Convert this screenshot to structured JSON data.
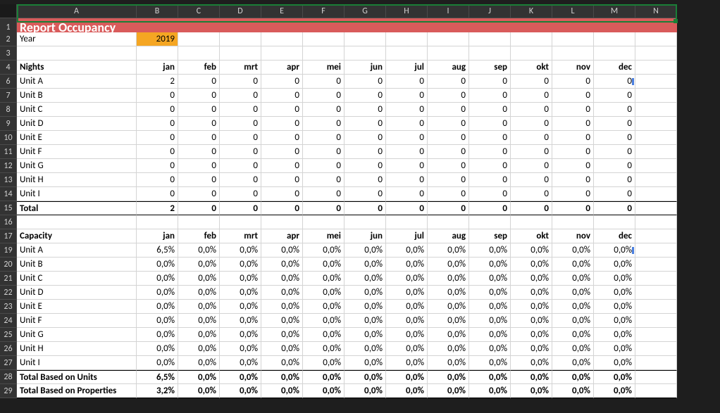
{
  "columns": [
    "A",
    "B",
    "C",
    "D",
    "E",
    "F",
    "G",
    "H",
    "I",
    "J",
    "K",
    "L",
    "M",
    "N"
  ],
  "row_numbers": [
    1,
    2,
    3,
    4,
    6,
    7,
    8,
    9,
    10,
    11,
    12,
    13,
    14,
    15,
    16,
    17,
    19,
    20,
    21,
    22,
    23,
    24,
    25,
    26,
    27,
    28,
    29
  ],
  "title": "Report Occupancy",
  "year_label": "Year",
  "year_value": "2019",
  "months": [
    "jan",
    "feb",
    "mrt",
    "apr",
    "mei",
    "jun",
    "jul",
    "aug",
    "sep",
    "okt",
    "nov",
    "dec"
  ],
  "section_nights": "Nights",
  "section_capacity": "Capacity",
  "units": [
    "Unit A",
    "Unit B",
    "Unit C",
    "Unit D",
    "Unit E",
    "Unit F",
    "Unit G",
    "Unit H",
    "Unit I"
  ],
  "nights_data": [
    [
      2,
      0,
      0,
      0,
      0,
      0,
      0,
      0,
      0,
      0,
      0,
      0
    ],
    [
      0,
      0,
      0,
      0,
      0,
      0,
      0,
      0,
      0,
      0,
      0,
      0
    ],
    [
      0,
      0,
      0,
      0,
      0,
      0,
      0,
      0,
      0,
      0,
      0,
      0
    ],
    [
      0,
      0,
      0,
      0,
      0,
      0,
      0,
      0,
      0,
      0,
      0,
      0
    ],
    [
      0,
      0,
      0,
      0,
      0,
      0,
      0,
      0,
      0,
      0,
      0,
      0
    ],
    [
      0,
      0,
      0,
      0,
      0,
      0,
      0,
      0,
      0,
      0,
      0,
      0
    ],
    [
      0,
      0,
      0,
      0,
      0,
      0,
      0,
      0,
      0,
      0,
      0,
      0
    ],
    [
      0,
      0,
      0,
      0,
      0,
      0,
      0,
      0,
      0,
      0,
      0,
      0
    ],
    [
      0,
      0,
      0,
      0,
      0,
      0,
      0,
      0,
      0,
      0,
      0,
      0
    ]
  ],
  "nights_total_label": "Total",
  "nights_total": [
    2,
    0,
    0,
    0,
    0,
    0,
    0,
    0,
    0,
    0,
    0,
    0
  ],
  "capacity_data": [
    [
      "6,5%",
      "0,0%",
      "0,0%",
      "0,0%",
      "0,0%",
      "0,0%",
      "0,0%",
      "0,0%",
      "0,0%",
      "0,0%",
      "0,0%",
      "0,0%"
    ],
    [
      "0,0%",
      "0,0%",
      "0,0%",
      "0,0%",
      "0,0%",
      "0,0%",
      "0,0%",
      "0,0%",
      "0,0%",
      "0,0%",
      "0,0%",
      "0,0%"
    ],
    [
      "0,0%",
      "0,0%",
      "0,0%",
      "0,0%",
      "0,0%",
      "0,0%",
      "0,0%",
      "0,0%",
      "0,0%",
      "0,0%",
      "0,0%",
      "0,0%"
    ],
    [
      "0,0%",
      "0,0%",
      "0,0%",
      "0,0%",
      "0,0%",
      "0,0%",
      "0,0%",
      "0,0%",
      "0,0%",
      "0,0%",
      "0,0%",
      "0,0%"
    ],
    [
      "0,0%",
      "0,0%",
      "0,0%",
      "0,0%",
      "0,0%",
      "0,0%",
      "0,0%",
      "0,0%",
      "0,0%",
      "0,0%",
      "0,0%",
      "0,0%"
    ],
    [
      "0,0%",
      "0,0%",
      "0,0%",
      "0,0%",
      "0,0%",
      "0,0%",
      "0,0%",
      "0,0%",
      "0,0%",
      "0,0%",
      "0,0%",
      "0,0%"
    ],
    [
      "0,0%",
      "0,0%",
      "0,0%",
      "0,0%",
      "0,0%",
      "0,0%",
      "0,0%",
      "0,0%",
      "0,0%",
      "0,0%",
      "0,0%",
      "0,0%"
    ],
    [
      "0,0%",
      "0,0%",
      "0,0%",
      "0,0%",
      "0,0%",
      "0,0%",
      "0,0%",
      "0,0%",
      "0,0%",
      "0,0%",
      "0,0%",
      "0,0%"
    ],
    [
      "0,0%",
      "0,0%",
      "0,0%",
      "0,0%",
      "0,0%",
      "0,0%",
      "0,0%",
      "0,0%",
      "0,0%",
      "0,0%",
      "0,0%",
      "0,0%"
    ]
  ],
  "cap_total_units_label": "Total Based on Units",
  "cap_total_units": [
    "6,5%",
    "0,0%",
    "0,0%",
    "0,0%",
    "0,0%",
    "0,0%",
    "0,0%",
    "0,0%",
    "0,0%",
    "0,0%",
    "0,0%",
    "0,0%"
  ],
  "cap_total_props_label": "Total Based on Properties",
  "cap_total_props": [
    "3,2%",
    "0,0%",
    "0,0%",
    "0,0%",
    "0,0%",
    "0,0%",
    "0,0%",
    "0,0%",
    "0,0%",
    "0,0%",
    "0,0%",
    "0,0%"
  ]
}
